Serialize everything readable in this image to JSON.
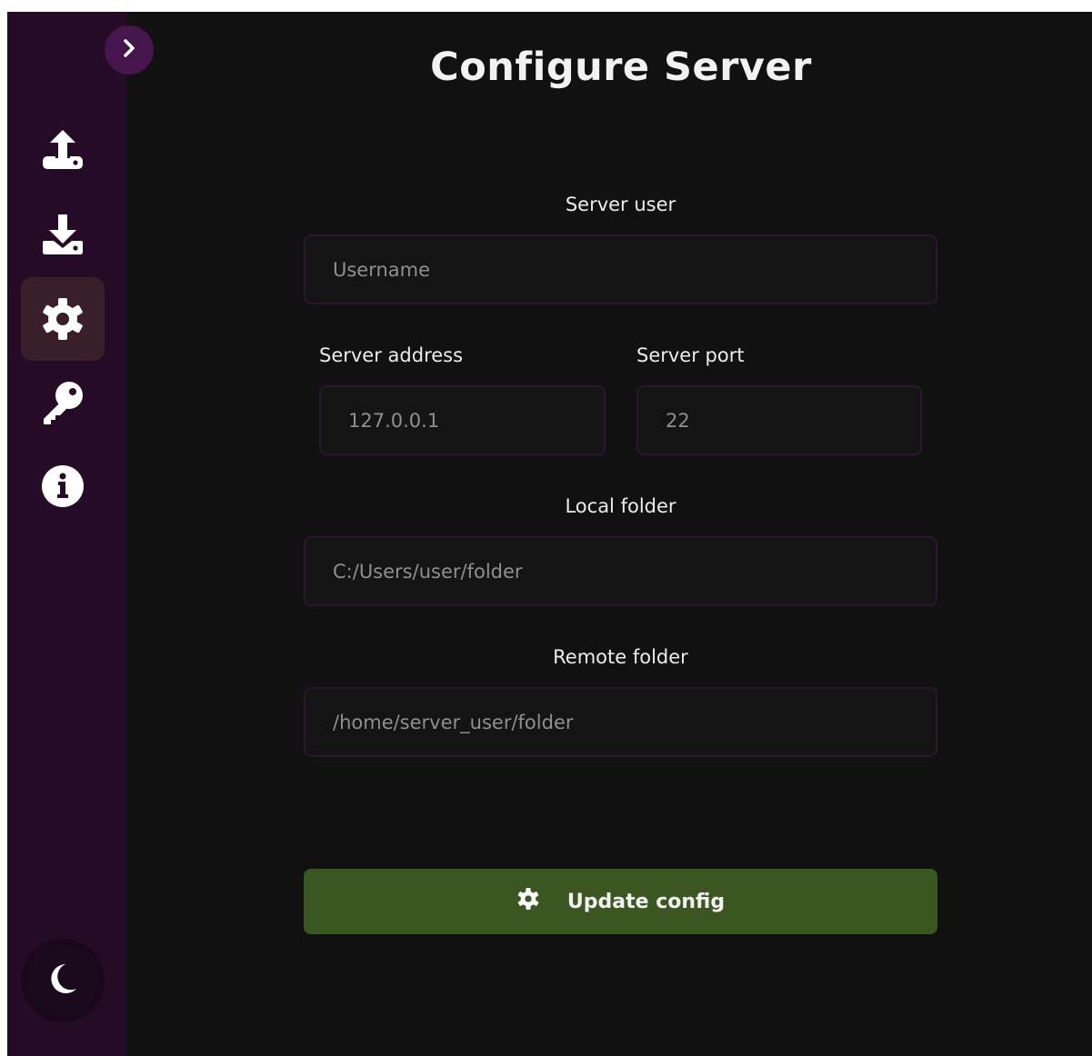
{
  "page": {
    "title": "Configure Server"
  },
  "sidebar": {
    "toggle_icon": "chevron-right-icon",
    "items": [
      {
        "icon": "upload-icon",
        "active": false
      },
      {
        "icon": "download-icon",
        "active": false
      },
      {
        "icon": "gear-icon",
        "active": true
      },
      {
        "icon": "key-icon",
        "active": false
      },
      {
        "icon": "info-icon",
        "active": false
      }
    ],
    "theme_icon": "moon-icon"
  },
  "form": {
    "server_user": {
      "label": "Server user",
      "placeholder": "Username",
      "value": ""
    },
    "server_address": {
      "label": "Server address",
      "placeholder": "127.0.0.1",
      "value": ""
    },
    "server_port": {
      "label": "Server port",
      "placeholder": "22",
      "value": ""
    },
    "local_folder": {
      "label": "Local folder",
      "placeholder": "C:/Users/user/folder",
      "value": ""
    },
    "remote_folder": {
      "label": "Remote folder",
      "placeholder": "/home/server_user/folder",
      "value": ""
    },
    "submit": {
      "label": "Update config",
      "icon": "gear-icon"
    }
  },
  "colors": {
    "sidebar_bg": "#250b26",
    "main_bg": "#111111",
    "active_nav_bg": "#3a1f2b",
    "toggle_bg": "#46154d",
    "field_border": "#2b1530",
    "button_bg": "#3c5621"
  }
}
